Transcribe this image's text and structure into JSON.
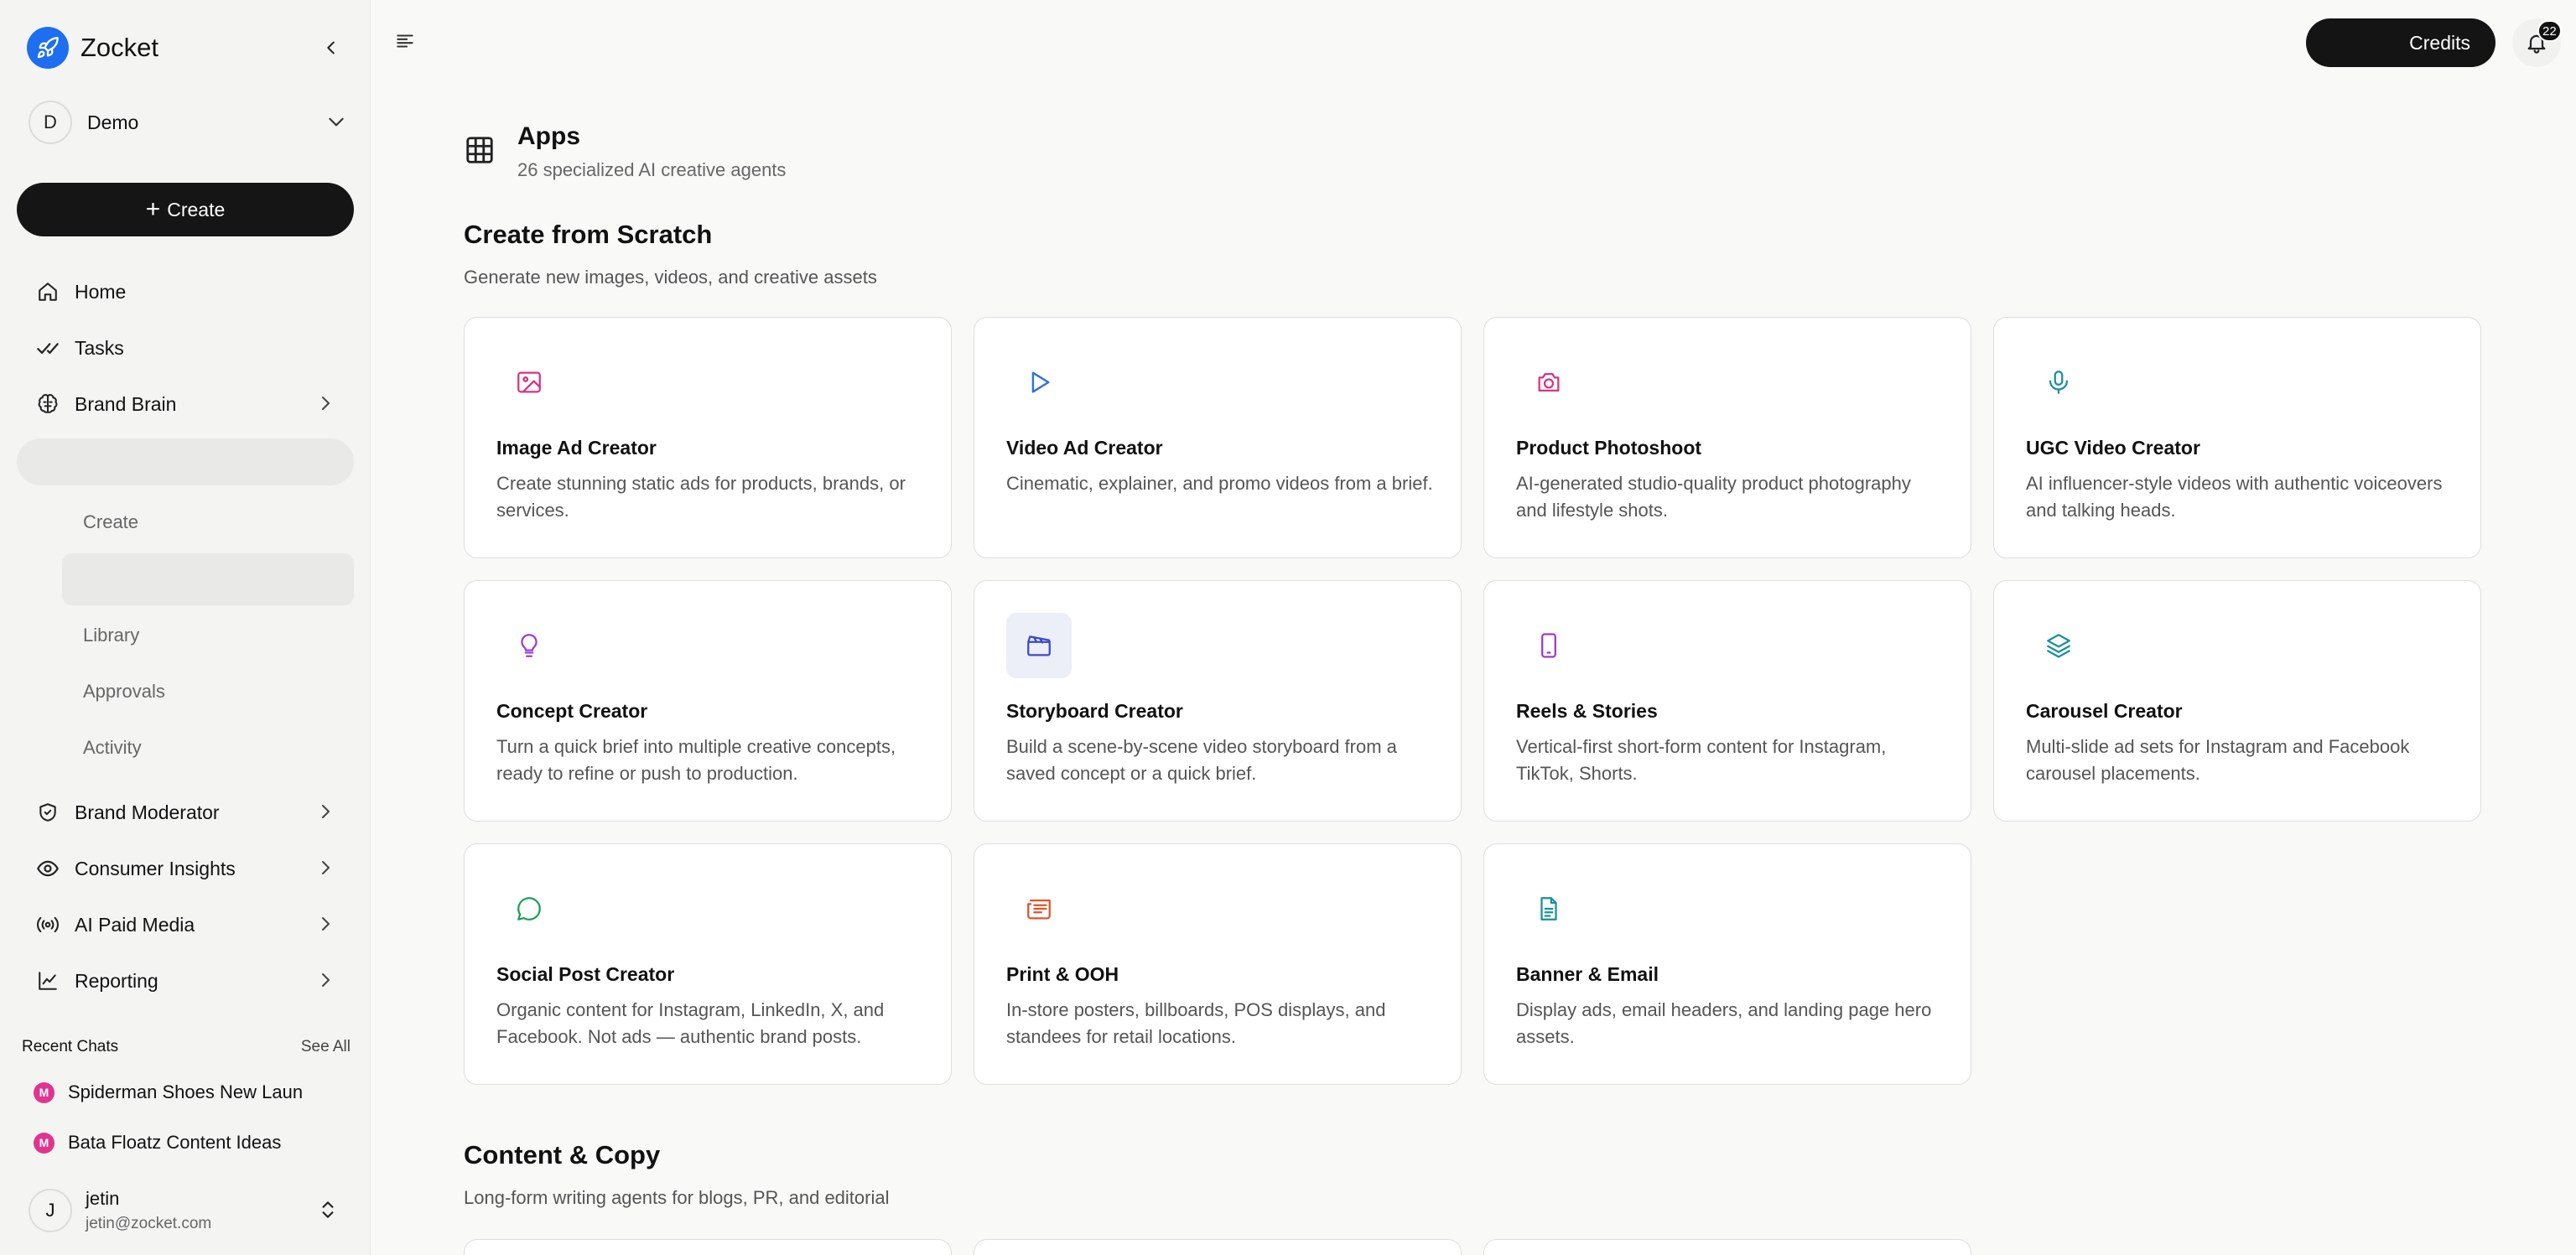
{
  "brand": {
    "name": "Zocket",
    "color": "#1e6ef2"
  },
  "workspace": {
    "initial": "D",
    "name": "Demo"
  },
  "sidebar": {
    "create_label": "Create",
    "nav": [
      {
        "label": "Home",
        "icon": "home-icon"
      },
      {
        "label": "Tasks",
        "icon": "check-double-icon"
      },
      {
        "label": "Brand Brain",
        "icon": "brain-icon"
      }
    ],
    "sub_items": [
      "Create",
      "Library",
      "Approvals",
      "Activity"
    ],
    "nav2": [
      {
        "label": "Brand Moderator",
        "icon": "shield-check-icon"
      },
      {
        "label": "Consumer Insights",
        "icon": "eye-icon"
      },
      {
        "label": "AI Paid Media",
        "icon": "broadcast-icon"
      },
      {
        "label": "Reporting",
        "icon": "line-chart-icon"
      }
    ],
    "recent": {
      "title": "Recent Chats",
      "see_all": "See All",
      "chats": [
        {
          "badge": "M",
          "title": "Spiderman Shoes New Laun"
        },
        {
          "badge": "M",
          "title": "Bata Floatz Content Ideas"
        }
      ]
    },
    "user": {
      "initial": "J",
      "name": "jetin",
      "email": "jetin@zocket.com"
    }
  },
  "topbar": {
    "credits_label": "Credits",
    "notification_count": "22"
  },
  "page": {
    "title": "Apps",
    "subtitle": "26 specialized AI creative agents"
  },
  "sections": [
    {
      "title": "Create from Scratch",
      "subtitle": "Generate new images, videos, and creative assets",
      "cards": [
        {
          "title": "Image Ad Creator",
          "desc": "Create stunning static ads for products, brands, or services.",
          "icon": "image-icon",
          "color": "#d63384"
        },
        {
          "title": "Video Ad Creator",
          "desc": "Cinematic, explainer, and promo videos from a brief.",
          "icon": "play-icon",
          "color": "#2f6fe4"
        },
        {
          "title": "Product Photoshoot",
          "desc": "AI-generated studio-quality product photography and lifestyle shots.",
          "icon": "camera-icon",
          "color": "#d63384"
        },
        {
          "title": "UGC Video Creator",
          "desc": "AI influencer-style videos with authentic voiceovers and talking heads.",
          "icon": "microphone-icon",
          "color": "#1a8fa0"
        },
        {
          "title": "Concept Creator",
          "desc": "Turn a quick brief into multiple creative concepts, ready to refine or push to production.",
          "icon": "lightbulb-icon",
          "color": "#9b3fd6"
        },
        {
          "title": "Storyboard Creator",
          "desc": "Build a scene-by-scene video storyboard from a saved concept or a quick brief.",
          "icon": "clapperboard-icon",
          "color": "#3d48c8",
          "highlight": true
        },
        {
          "title": "Reels & Stories",
          "desc": "Vertical-first short-form content for Instagram, TikTok, Shorts.",
          "icon": "smartphone-icon",
          "color": "#a236c9"
        },
        {
          "title": "Carousel Creator",
          "desc": "Multi-slide ad sets for Instagram and Facebook carousel placements.",
          "icon": "layers-icon",
          "color": "#1a8fa0"
        },
        {
          "title": "Social Post Creator",
          "desc": "Organic content for Instagram, LinkedIn, X, and Facebook. Not ads — authentic brand posts.",
          "icon": "chat-bubble-icon",
          "color": "#1f9e5a"
        },
        {
          "title": "Print & OOH",
          "desc": "In-store posters, billboards, POS displays, and standees for retail locations.",
          "icon": "newspaper-icon",
          "color": "#e0532a"
        },
        {
          "title": "Banner & Email",
          "desc": "Display ads, email headers, and landing page hero assets.",
          "icon": "document-icon",
          "color": "#1a8fa0"
        }
      ]
    },
    {
      "title": "Content & Copy",
      "subtitle": "Long-form writing agents for blogs, PR, and editorial"
    }
  ]
}
